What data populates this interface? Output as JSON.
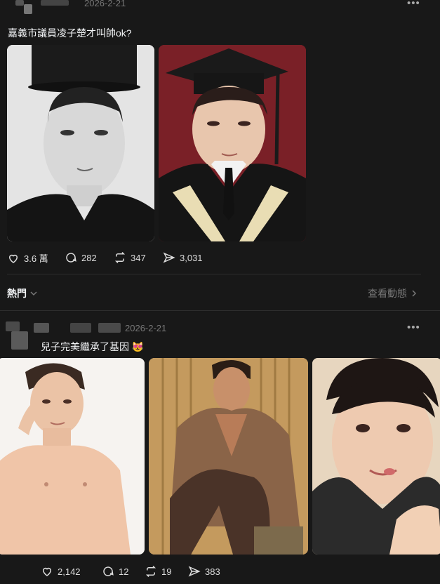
{
  "post1": {
    "date": "2026-2-21",
    "more": "•••",
    "text": "嘉義市議員凌子楚才叫帥ok?",
    "actions": {
      "likes": "3.6 萬",
      "comments": "282",
      "reposts": "347",
      "shares": "3,031"
    }
  },
  "hot": {
    "label": "熱門",
    "link": "查看動態"
  },
  "post2": {
    "date": "2026-2-21",
    "more": "•••",
    "text": "兒子完美繼承了基因 😻",
    "actions": {
      "likes": "2,142",
      "comments": "12",
      "reposts": "19",
      "shares": "383"
    }
  },
  "icons": [
    "heart-icon",
    "comment-icon",
    "repost-icon",
    "share-icon",
    "chevron-down-icon",
    "chevron-right-icon"
  ]
}
